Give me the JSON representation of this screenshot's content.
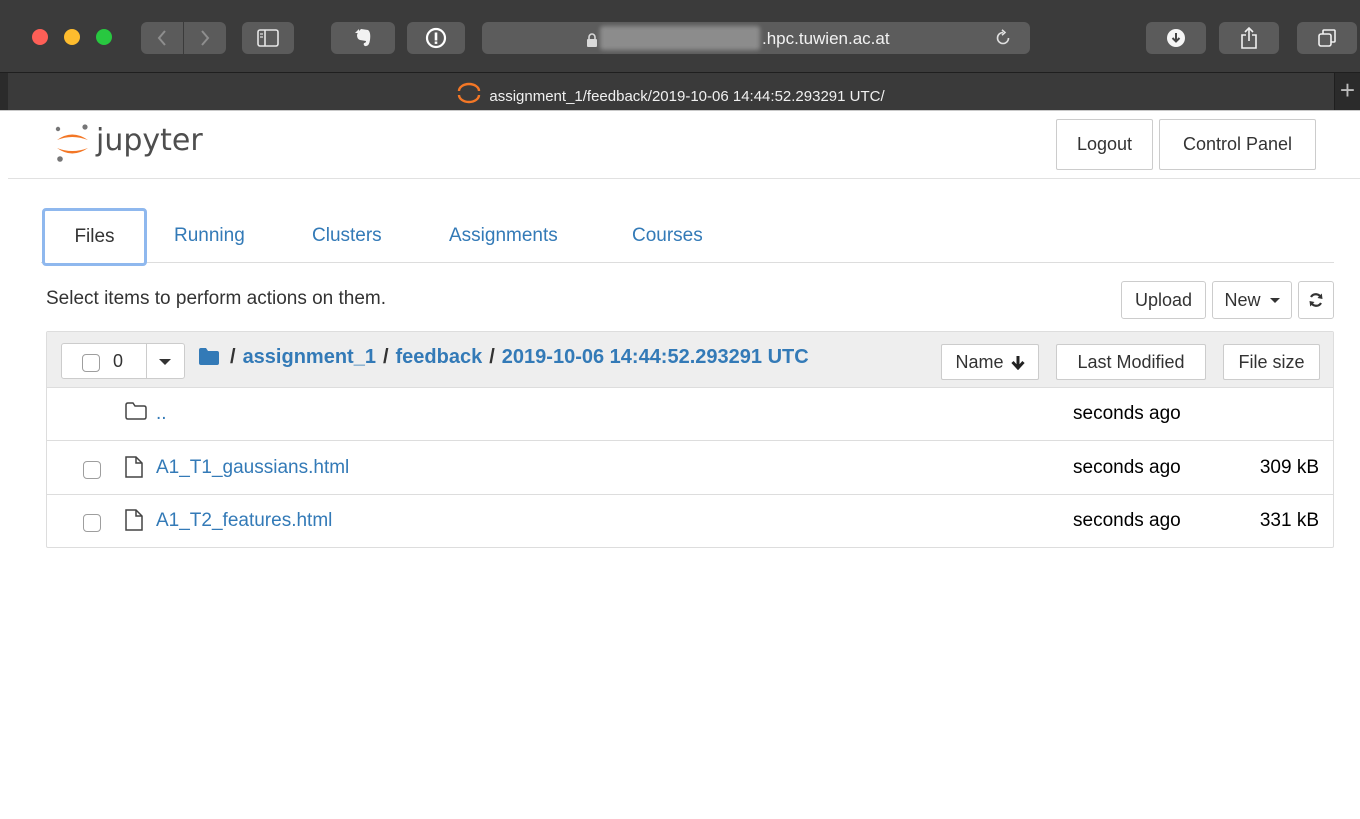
{
  "browser": {
    "address_host": ".hpc.tuwien.ac.at",
    "tab_title": "assignment_1/feedback/2019-10-06 14:44:52.293291 UTC/",
    "new_tab_symbol": "+",
    "icons": [
      "back-icon",
      "forward-icon",
      "sidebar-icon",
      "evernote-icon",
      "password-icon",
      "lock-icon",
      "reload-icon",
      "download-icon",
      "share-icon",
      "tabs-overview-icon"
    ]
  },
  "header": {
    "logo_text": "jupyter",
    "logout_label": "Logout",
    "control_panel_label": "Control Panel"
  },
  "tabs": [
    {
      "label": "Files",
      "active": true
    },
    {
      "label": "Running",
      "active": false
    },
    {
      "label": "Clusters",
      "active": false
    },
    {
      "label": "Assignments",
      "active": false
    },
    {
      "label": "Courses",
      "active": false
    }
  ],
  "actions": {
    "hint": "Select items to perform actions on them.",
    "upload_label": "Upload",
    "new_label": "New"
  },
  "list_header": {
    "selected_count": "0",
    "breadcrumb": [
      "assignment_1",
      "feedback",
      "2019-10-06 14:44:52.293291 UTC"
    ],
    "separator": "/",
    "sort_name_label": "Name",
    "sort_modified_label": "Last Modified",
    "sort_size_label": "File size"
  },
  "files": [
    {
      "name": "..",
      "modified": "seconds ago",
      "size": "",
      "type": "folder"
    },
    {
      "name": "A1_T1_gaussians.html",
      "modified": "seconds ago",
      "size": "309 kB",
      "type": "file"
    },
    {
      "name": "A1_T2_features.html",
      "modified": "seconds ago",
      "size": "331 kB",
      "type": "file"
    }
  ],
  "colors": {
    "link": "#337ab7",
    "active_tab_border": "#8fb8ee",
    "jupyter_orange": "#f37726"
  }
}
